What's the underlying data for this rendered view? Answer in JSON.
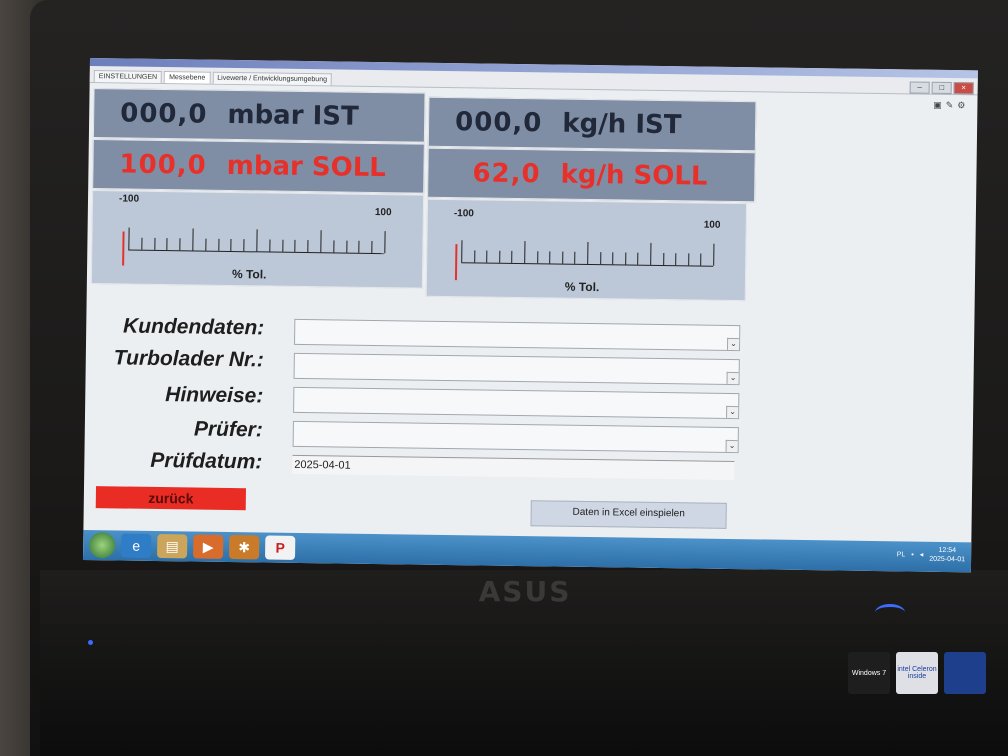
{
  "tabs": [
    "EINSTELLUNGEN",
    "Messebene",
    "Livewerte / Entwicklungsumgebung"
  ],
  "active_tab": "Messebene",
  "pressure": {
    "ist_value": "000,0",
    "ist_unit": "mbar IST",
    "soll_value": "100,0",
    "soll_unit": "mbar SOLL",
    "gauge": {
      "min": "-100",
      "max": "100",
      "label": "% Tol.",
      "level_fraction": 0.0
    }
  },
  "flow": {
    "ist_value": "000,0",
    "ist_unit": "kg/h IST",
    "soll_value": "62,0",
    "soll_unit": "kg/h SOLL",
    "gauge": {
      "min": "-100",
      "max": "100",
      "label": "% Tol.",
      "level_fraction": 0.0
    }
  },
  "form": {
    "kundendaten_label": "Kundendaten:",
    "kundendaten_value": "",
    "turbolader_label": "Turbolader Nr.:",
    "turbolader_value": "",
    "hinweise_label": "Hinweise:",
    "hinweise_value": "",
    "pruefer_label": "Prüfer:",
    "pruefer_value": "",
    "pruefdatum_label": "Prüfdatum:",
    "pruefdatum_value": "2025-04-01"
  },
  "buttons": {
    "back": "zurück",
    "excel": "Daten in Excel einspielen"
  },
  "taskbar": {
    "lang": "PL",
    "time": "12:54",
    "date": "2025-04-01"
  },
  "hardware": {
    "brand": "ASUS",
    "sticker_windows": "Windows 7",
    "sticker_intel": "intel Celeron inside"
  },
  "colors": {
    "panel": "#7f8ea4",
    "soll": "#e8302b",
    "ist": "#20283a",
    "gauge": "#bcc7d8",
    "back_button": "#e92c24"
  }
}
